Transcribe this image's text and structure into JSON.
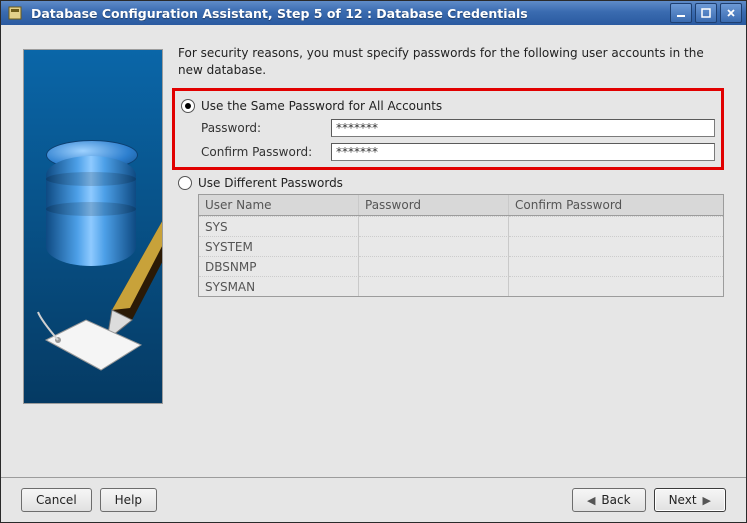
{
  "window": {
    "title": "Database Configuration Assistant, Step 5 of 12 : Database Credentials"
  },
  "instruction": "For security reasons, you must specify passwords for the following user accounts in the new database.",
  "options": {
    "same": {
      "label": "Use the Same Password for All Accounts",
      "password_label": "Password:",
      "password_value": "*******",
      "confirm_label": "Confirm Password:",
      "confirm_value": "*******"
    },
    "diff": {
      "label": "Use Different Passwords",
      "columns": [
        "User Name",
        "Password",
        "Confirm Password"
      ],
      "rows": [
        {
          "user": "SYS",
          "pw": "",
          "cpw": ""
        },
        {
          "user": "SYSTEM",
          "pw": "",
          "cpw": ""
        },
        {
          "user": "DBSNMP",
          "pw": "",
          "cpw": ""
        },
        {
          "user": "SYSMAN",
          "pw": "",
          "cpw": ""
        }
      ]
    }
  },
  "footer": {
    "cancel": "Cancel",
    "help": "Help",
    "back": "Back",
    "next": "Next"
  }
}
